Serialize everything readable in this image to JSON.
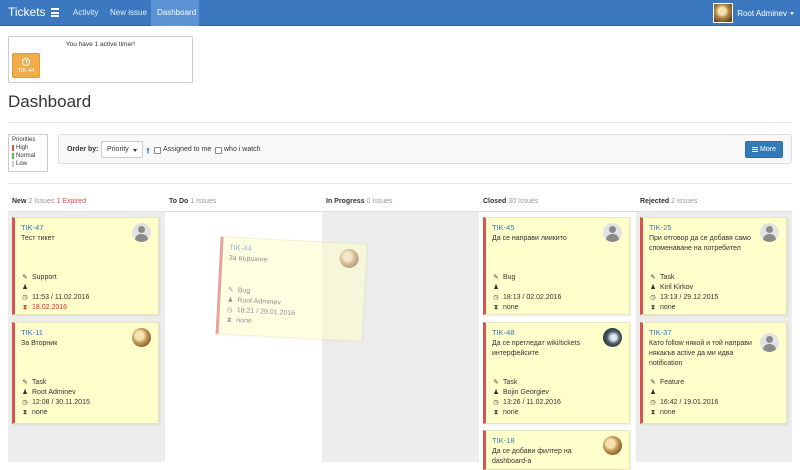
{
  "navbar": {
    "brand": "Tickets",
    "menu_icon": "hamburger-icon",
    "links": [
      "Activity",
      "New issue",
      "Dashboard"
    ],
    "active_link": "Dashboard",
    "user": {
      "name": "Root Adminev",
      "avatar_icon": "user-avatar-photo"
    },
    "colors": {
      "bar": "#3c78c0",
      "active": "#5a92d4"
    }
  },
  "timer": {
    "message": "You have 1 active timer!",
    "ticket": "TIK-44",
    "icon": "clock-icon",
    "color": "#f0ad4e"
  },
  "page_title": "Dashboard",
  "priorities": {
    "title": "Priorities",
    "items": [
      {
        "label": "High",
        "color": "#d9534f"
      },
      {
        "label": "Normal",
        "color": "#5cb85c"
      },
      {
        "label": "Low",
        "color": "#cccccc"
      }
    ]
  },
  "filter": {
    "order_by_label": "Order by:",
    "order_by_value": "Priority",
    "sort_icon": "arrow-up-icon",
    "assigned_label": "Assigned to me",
    "watch_label": "who i watch",
    "more_label": "More",
    "more_icon": "list-icon"
  },
  "columns": [
    {
      "name": "New",
      "count": "2 Issues",
      "expired": "1 Expired"
    },
    {
      "name": "To Do",
      "count": "1 Issues"
    },
    {
      "name": "In Progress",
      "count": "0 Issues"
    },
    {
      "name": "Closed",
      "count": "30 Issues"
    },
    {
      "name": "Rejected",
      "count": "2 Issues"
    }
  ],
  "cards": {
    "tik47": {
      "key": "TIK-47",
      "title": "Тест тикет",
      "type": "Support",
      "assignee": "",
      "created": "11:53 / 11.02.2016",
      "due": "18.02.2016"
    },
    "tik11": {
      "key": "TIK-11",
      "title": "За Вторник",
      "type": "Task",
      "assignee": "Root Adminev",
      "created": "12:08 / 30.11.2015",
      "due": "none"
    },
    "tik44": {
      "key": "TIK-44",
      "title": "За вършене",
      "type": "Bug",
      "assignee": "Root Adminev",
      "created": "18:21 / 29.01.2016",
      "due": "none"
    },
    "tik45": {
      "key": "TIK-45",
      "title": "Да се направи лиикито",
      "type": "Bug",
      "assignee": "",
      "created": "18:13 / 02.02.2016",
      "due": "none"
    },
    "tik48": {
      "key": "TIK-48",
      "title": "Да се прегледат wiki/tickets интерфейсите",
      "type": "Task",
      "assignee": "Bojin Georgiev",
      "created": "13:26 / 11.02.2016",
      "due": "none"
    },
    "tik18": {
      "key": "TIK-18",
      "title": "Да се добави филтер на dashboard-а"
    },
    "tik25": {
      "key": "TIK-25",
      "title": "При отговор да се добавя само споменаване на потребител",
      "type": "Task",
      "assignee": "Kiril Kirkov",
      "created": "13:13 / 29.12.2015",
      "due": "none"
    },
    "tik37": {
      "key": "TIK-37",
      "title": "Като follow някой и той направи някакъв active да ми идва notification",
      "type": "Feature",
      "assignee": "",
      "created": "16:42 / 19.01.2016",
      "due": "none"
    }
  }
}
